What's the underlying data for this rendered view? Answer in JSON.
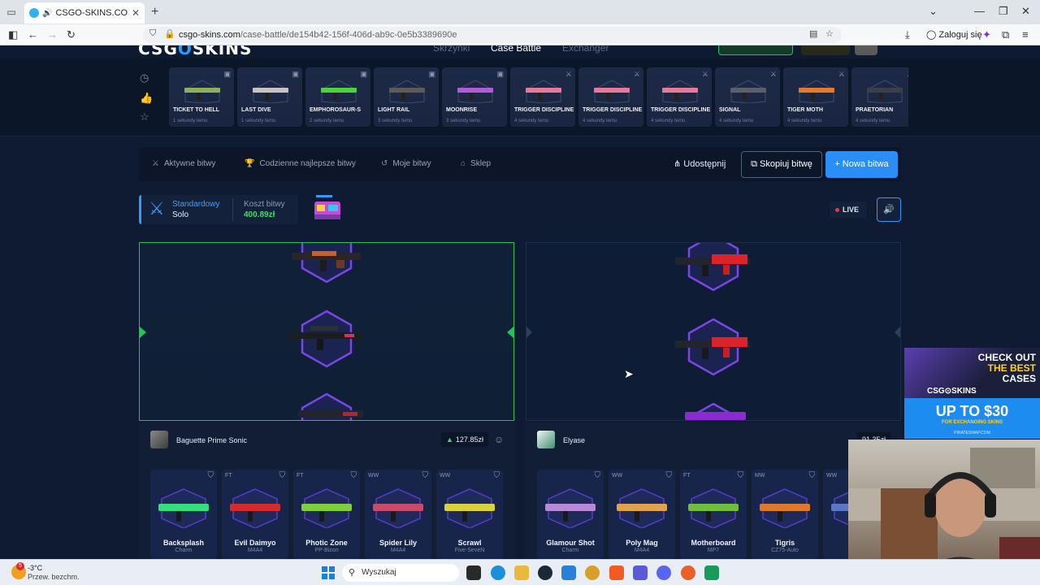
{
  "browser": {
    "tab_title": "CSGO-SKINS.COM - Najlep",
    "url_host": "csgo-skins.com",
    "url_path": "/case-battle/de154b42-156f-406d-ab9c-0e5b3389690e",
    "login_label": "Zaloguj się"
  },
  "site": {
    "logo_left": "CSG",
    "logo_o": "O",
    "logo_right": "SKINS",
    "nav": [
      "Skrzynki",
      "Case Battle",
      "Exchanger"
    ]
  },
  "drops": [
    {
      "name": "TICKET TO HELL",
      "time": "1 sekundy temu",
      "color": "#8fb05a"
    },
    {
      "name": "LAST DIVE",
      "time": "1 sekundy temu",
      "color": "#c7c3c0"
    },
    {
      "name": "EMPHOROSAUR-S",
      "time": "2 sekundy temu",
      "color": "#4ed23a"
    },
    {
      "name": "LIGHT RAIL",
      "time": "3 sekundy temu",
      "color": "#5f5a55"
    },
    {
      "name": "MOONRISE",
      "time": "3 sekundy temu",
      "color": "#b35ad8"
    },
    {
      "name": "TRIGGER DISCIPLINE",
      "time": "4 sekundy temu",
      "color": "#e8799a"
    },
    {
      "name": "TRIGGER DISCIPLINE",
      "time": "4 sekundy temu",
      "color": "#e8799a"
    },
    {
      "name": "TRIGGER DISCIPLINE",
      "time": "4 sekundy temu",
      "color": "#e8799a"
    },
    {
      "name": "SIGNAL",
      "time": "4 sekundy temu",
      "color": "#5a5f6a"
    },
    {
      "name": "TIGER MOTH",
      "time": "4 sekundy temu",
      "color": "#e57b2a"
    },
    {
      "name": "PRAETORIAN",
      "time": "4 sekundy temu",
      "color": "#3b3f47"
    }
  ],
  "toolbar": {
    "active": "Aktywne bitwy",
    "daily": "Codzienne najlepsze bitwy",
    "mine": "Moje bitwy",
    "shop": "Sklep",
    "share": "Udostępnij",
    "copy": "Skopiuj bitwę",
    "new": "+ Nowa bitwa"
  },
  "battle": {
    "mode": "Standardowy",
    "mode_sub": "Solo",
    "cost_label": "Koszt bitwy",
    "cost_value": "400.89zł",
    "live": "LIVE"
  },
  "players": [
    {
      "name": "Baguette Prime Sonic",
      "total": "127.85zł",
      "items": [
        {
          "wear": "",
          "name": "Backsplash",
          "type": "Charm",
          "color": "#35e07a"
        },
        {
          "wear": "FT",
          "name": "Evil Daimyo",
          "type": "M4A4",
          "color": "#d72a2a"
        },
        {
          "wear": "FT",
          "name": "Photic Zone",
          "type": "PP-Bizon",
          "color": "#7fcf3a"
        },
        {
          "wear": "WW",
          "name": "Spider Lily",
          "type": "M4A4",
          "color": "#c94a6a"
        },
        {
          "wear": "WW",
          "name": "Scrawl",
          "type": "Five-SeveN",
          "color": "#d9d23a"
        }
      ]
    },
    {
      "name": "Elyase",
      "total": "91.35zł",
      "items": [
        {
          "wear": "",
          "name": "Glamour Shot",
          "type": "Charm",
          "color": "#b78ad8"
        },
        {
          "wear": "WW",
          "name": "Poly Mag",
          "type": "M4A4",
          "color": "#e0a24a"
        },
        {
          "wear": "FT",
          "name": "Motherboard",
          "type": "MP7",
          "color": "#6fbf3a"
        },
        {
          "wear": "MW",
          "name": "Tigris",
          "type": "CZ75-Auto",
          "color": "#e0782a"
        },
        {
          "wear": "WW",
          "name": "W",
          "type": "G",
          "color": "#5a78c8"
        }
      ]
    }
  ],
  "ad": {
    "line1": "CHECK OUT",
    "line2": "THE BEST",
    "line3": "CASES",
    "logo": "CSG⊙SKINS",
    "big": "UP TO $30",
    "small": "FOR EXCHANGING SKINS",
    "foot": "PIRATESWAP.COM"
  },
  "taskbar": {
    "temp": "-3°C",
    "weather": "Przew. bezchm.",
    "badge": "5",
    "search_placeholder": "Wyszukaj"
  },
  "colors": {
    "accent": "#2f9bff",
    "win_green": "#22c35a",
    "hex_purple": "#7b45e8"
  },
  "icons": [
    "clock-icon",
    "thumbs-up-icon",
    "star-icon",
    "crossed-swords-icon",
    "trophy-icon",
    "history-icon",
    "basket-icon",
    "share-icon",
    "copy-icon",
    "speaker-icon",
    "smile-icon",
    "shield-icon"
  ]
}
